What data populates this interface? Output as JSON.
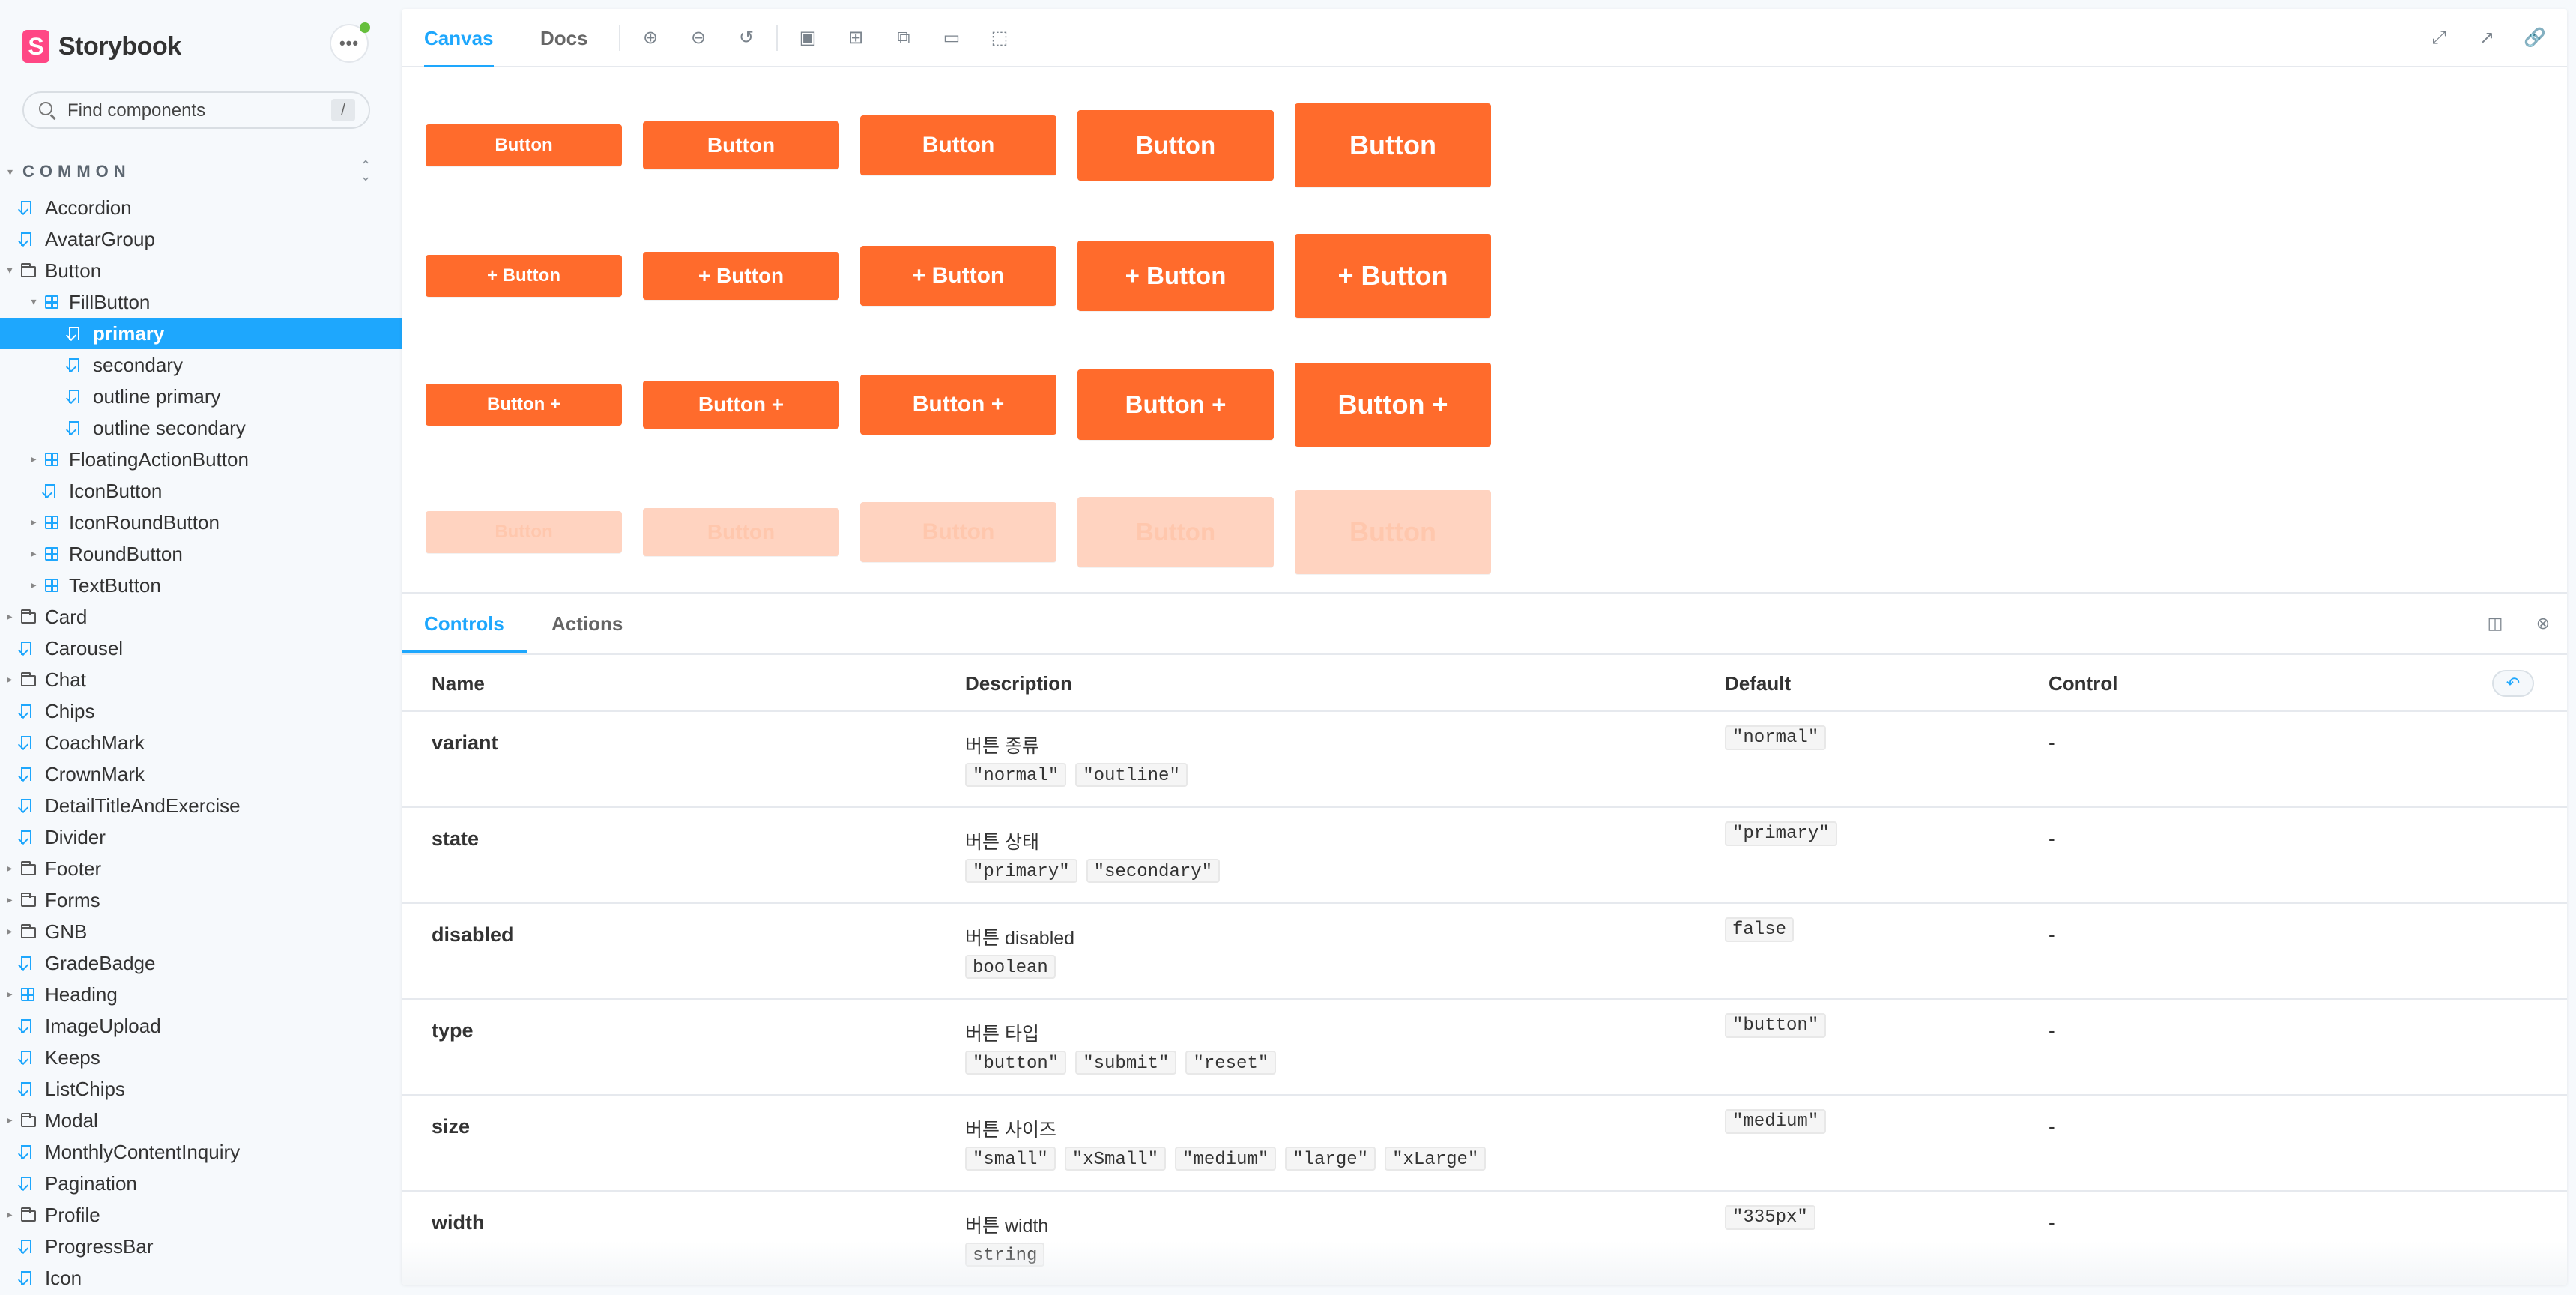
{
  "brand": {
    "logo_letter": "S",
    "name": "Storybook",
    "menu_icon": "ellipsis-icon",
    "menu_glyph": "•••"
  },
  "search": {
    "placeholder": "Find components",
    "shortcut": "/"
  },
  "section": {
    "title": "COMMON"
  },
  "tree": [
    {
      "label": "Accordion",
      "kind": "story",
      "depth": 0,
      "caret": false
    },
    {
      "label": "AvatarGroup",
      "kind": "story",
      "depth": 0,
      "caret": false
    },
    {
      "label": "Button",
      "kind": "folder",
      "depth": 0,
      "caret": "open"
    },
    {
      "label": "FillButton",
      "kind": "component",
      "depth": 1,
      "caret": "open"
    },
    {
      "label": "primary",
      "kind": "story",
      "depth": 2,
      "caret": false,
      "active": true
    },
    {
      "label": "secondary",
      "kind": "story",
      "depth": 2,
      "caret": false
    },
    {
      "label": "outline primary",
      "kind": "story",
      "depth": 2,
      "caret": false
    },
    {
      "label": "outline secondary",
      "kind": "story",
      "depth": 2,
      "caret": false
    },
    {
      "label": "FloatingActionButton",
      "kind": "component",
      "depth": 1,
      "caret": "closed"
    },
    {
      "label": "IconButton",
      "kind": "story",
      "depth": 1,
      "caret": false
    },
    {
      "label": "IconRoundButton",
      "kind": "component",
      "depth": 1,
      "caret": "closed"
    },
    {
      "label": "RoundButton",
      "kind": "component",
      "depth": 1,
      "caret": "closed"
    },
    {
      "label": "TextButton",
      "kind": "component",
      "depth": 1,
      "caret": "closed"
    },
    {
      "label": "Card",
      "kind": "folder",
      "depth": 0,
      "caret": "closed"
    },
    {
      "label": "Carousel",
      "kind": "story",
      "depth": 0,
      "caret": false
    },
    {
      "label": "Chat",
      "kind": "folder",
      "depth": 0,
      "caret": "closed"
    },
    {
      "label": "Chips",
      "kind": "story",
      "depth": 0,
      "caret": false
    },
    {
      "label": "CoachMark",
      "kind": "story",
      "depth": 0,
      "caret": false
    },
    {
      "label": "CrownMark",
      "kind": "story",
      "depth": 0,
      "caret": false
    },
    {
      "label": "DetailTitleAndExercise",
      "kind": "story",
      "depth": 0,
      "caret": false
    },
    {
      "label": "Divider",
      "kind": "story",
      "depth": 0,
      "caret": false
    },
    {
      "label": "Footer",
      "kind": "folder",
      "depth": 0,
      "caret": "closed"
    },
    {
      "label": "Forms",
      "kind": "folder",
      "depth": 0,
      "caret": "closed"
    },
    {
      "label": "GNB",
      "kind": "folder",
      "depth": 0,
      "caret": "closed"
    },
    {
      "label": "GradeBadge",
      "kind": "story",
      "depth": 0,
      "caret": false
    },
    {
      "label": "Heading",
      "kind": "component",
      "depth": 0,
      "caret": "closed"
    },
    {
      "label": "ImageUpload",
      "kind": "story",
      "depth": 0,
      "caret": false
    },
    {
      "label": "Keeps",
      "kind": "story",
      "depth": 0,
      "caret": false
    },
    {
      "label": "ListChips",
      "kind": "story",
      "depth": 0,
      "caret": false
    },
    {
      "label": "Modal",
      "kind": "folder",
      "depth": 0,
      "caret": "closed"
    },
    {
      "label": "MonthlyContentInquiry",
      "kind": "story",
      "depth": 0,
      "caret": false
    },
    {
      "label": "Pagination",
      "kind": "story",
      "depth": 0,
      "caret": false
    },
    {
      "label": "Profile",
      "kind": "folder",
      "depth": 0,
      "caret": "closed"
    },
    {
      "label": "ProgressBar",
      "kind": "story",
      "depth": 0,
      "caret": false
    },
    {
      "label": "Icon",
      "kind": "story",
      "depth": 0,
      "caret": false
    }
  ],
  "toolbar": {
    "tabs": [
      "Canvas",
      "Docs"
    ],
    "active_tab": "Canvas",
    "left_icons": [
      "zoom-in-icon",
      "zoom-out-icon",
      "zoom-reset-icon",
      "background-icon",
      "grid-icon",
      "viewport-icon",
      "measure-icon",
      "outline-icon"
    ],
    "right_icons": [
      "fullscreen-icon",
      "open-new-tab-icon",
      "copy-link-icon"
    ]
  },
  "canvas": {
    "rows": [
      {
        "name": "plain",
        "labels": [
          "Button",
          "Button",
          "Button",
          "Button",
          "Button"
        ]
      },
      {
        "name": "leading-plus",
        "labels": [
          "+ Button",
          "+ Button",
          "+ Button",
          "+ Button",
          "+ Button"
        ]
      },
      {
        "name": "trailing-plus",
        "labels": [
          "Button +",
          "Button +",
          "Button +",
          "Button +",
          "Button +"
        ]
      },
      {
        "name": "disabled",
        "labels": [
          "Button",
          "Button",
          "Button",
          "Button",
          "Button"
        ]
      }
    ],
    "accent": "#ff6b2c",
    "disabled_color": "#ffd3c0"
  },
  "panel": {
    "tabs": [
      "Controls",
      "Actions"
    ],
    "active_tab": "Controls",
    "icons": [
      "panel-layout-icon",
      "close-panel-icon"
    ],
    "headers": {
      "name": "Name",
      "description": "Description",
      "default": "Default",
      "control": "Control"
    },
    "reset_icon": "undo-icon",
    "rows": [
      {
        "name": "variant",
        "desc": "버튼 종류",
        "options": [
          "\"normal\"",
          "\"outline\""
        ],
        "default": "\"normal\"",
        "control": "-"
      },
      {
        "name": "state",
        "desc": "버튼 상태",
        "options": [
          "\"primary\"",
          "\"secondary\""
        ],
        "default": "\"primary\"",
        "control": "-"
      },
      {
        "name": "disabled",
        "desc": "버튼 disabled",
        "options": [
          "boolean"
        ],
        "default": "false",
        "control": "-"
      },
      {
        "name": "type",
        "desc": "버튼 타입",
        "options": [
          "\"button\"",
          "\"submit\"",
          "\"reset\""
        ],
        "default": "\"button\"",
        "control": "-"
      },
      {
        "name": "size",
        "desc": "버튼 사이즈",
        "options": [
          "\"small\"",
          "\"xSmall\"",
          "\"medium\"",
          "\"large\"",
          "\"xLarge\""
        ],
        "default": "\"medium\"",
        "control": "-"
      },
      {
        "name": "width",
        "desc": "버튼 width",
        "options": [
          "string"
        ],
        "default": "\"335px\"",
        "control": "-"
      }
    ]
  }
}
